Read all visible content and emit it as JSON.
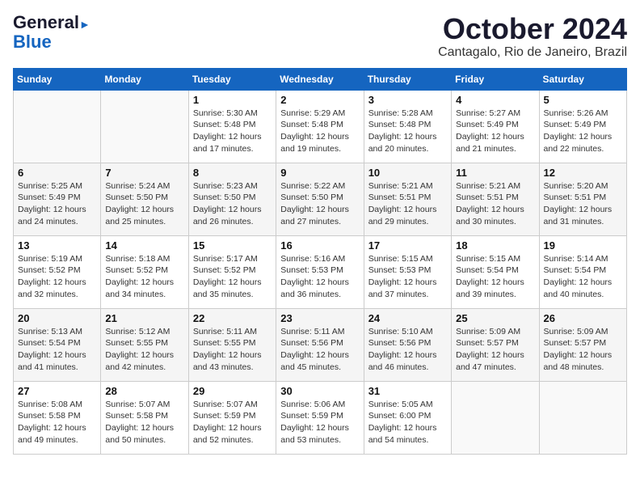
{
  "header": {
    "logo_line1": "General",
    "logo_line2": "Blue",
    "month": "October 2024",
    "location": "Cantagalo, Rio de Janeiro, Brazil"
  },
  "weekdays": [
    "Sunday",
    "Monday",
    "Tuesday",
    "Wednesday",
    "Thursday",
    "Friday",
    "Saturday"
  ],
  "weeks": [
    [
      {
        "day": "",
        "info": ""
      },
      {
        "day": "",
        "info": ""
      },
      {
        "day": "1",
        "info": "Sunrise: 5:30 AM\nSunset: 5:48 PM\nDaylight: 12 hours\nand 17 minutes."
      },
      {
        "day": "2",
        "info": "Sunrise: 5:29 AM\nSunset: 5:48 PM\nDaylight: 12 hours\nand 19 minutes."
      },
      {
        "day": "3",
        "info": "Sunrise: 5:28 AM\nSunset: 5:48 PM\nDaylight: 12 hours\nand 20 minutes."
      },
      {
        "day": "4",
        "info": "Sunrise: 5:27 AM\nSunset: 5:49 PM\nDaylight: 12 hours\nand 21 minutes."
      },
      {
        "day": "5",
        "info": "Sunrise: 5:26 AM\nSunset: 5:49 PM\nDaylight: 12 hours\nand 22 minutes."
      }
    ],
    [
      {
        "day": "6",
        "info": "Sunrise: 5:25 AM\nSunset: 5:49 PM\nDaylight: 12 hours\nand 24 minutes."
      },
      {
        "day": "7",
        "info": "Sunrise: 5:24 AM\nSunset: 5:50 PM\nDaylight: 12 hours\nand 25 minutes."
      },
      {
        "day": "8",
        "info": "Sunrise: 5:23 AM\nSunset: 5:50 PM\nDaylight: 12 hours\nand 26 minutes."
      },
      {
        "day": "9",
        "info": "Sunrise: 5:22 AM\nSunset: 5:50 PM\nDaylight: 12 hours\nand 27 minutes."
      },
      {
        "day": "10",
        "info": "Sunrise: 5:21 AM\nSunset: 5:51 PM\nDaylight: 12 hours\nand 29 minutes."
      },
      {
        "day": "11",
        "info": "Sunrise: 5:21 AM\nSunset: 5:51 PM\nDaylight: 12 hours\nand 30 minutes."
      },
      {
        "day": "12",
        "info": "Sunrise: 5:20 AM\nSunset: 5:51 PM\nDaylight: 12 hours\nand 31 minutes."
      }
    ],
    [
      {
        "day": "13",
        "info": "Sunrise: 5:19 AM\nSunset: 5:52 PM\nDaylight: 12 hours\nand 32 minutes."
      },
      {
        "day": "14",
        "info": "Sunrise: 5:18 AM\nSunset: 5:52 PM\nDaylight: 12 hours\nand 34 minutes."
      },
      {
        "day": "15",
        "info": "Sunrise: 5:17 AM\nSunset: 5:52 PM\nDaylight: 12 hours\nand 35 minutes."
      },
      {
        "day": "16",
        "info": "Sunrise: 5:16 AM\nSunset: 5:53 PM\nDaylight: 12 hours\nand 36 minutes."
      },
      {
        "day": "17",
        "info": "Sunrise: 5:15 AM\nSunset: 5:53 PM\nDaylight: 12 hours\nand 37 minutes."
      },
      {
        "day": "18",
        "info": "Sunrise: 5:15 AM\nSunset: 5:54 PM\nDaylight: 12 hours\nand 39 minutes."
      },
      {
        "day": "19",
        "info": "Sunrise: 5:14 AM\nSunset: 5:54 PM\nDaylight: 12 hours\nand 40 minutes."
      }
    ],
    [
      {
        "day": "20",
        "info": "Sunrise: 5:13 AM\nSunset: 5:54 PM\nDaylight: 12 hours\nand 41 minutes."
      },
      {
        "day": "21",
        "info": "Sunrise: 5:12 AM\nSunset: 5:55 PM\nDaylight: 12 hours\nand 42 minutes."
      },
      {
        "day": "22",
        "info": "Sunrise: 5:11 AM\nSunset: 5:55 PM\nDaylight: 12 hours\nand 43 minutes."
      },
      {
        "day": "23",
        "info": "Sunrise: 5:11 AM\nSunset: 5:56 PM\nDaylight: 12 hours\nand 45 minutes."
      },
      {
        "day": "24",
        "info": "Sunrise: 5:10 AM\nSunset: 5:56 PM\nDaylight: 12 hours\nand 46 minutes."
      },
      {
        "day": "25",
        "info": "Sunrise: 5:09 AM\nSunset: 5:57 PM\nDaylight: 12 hours\nand 47 minutes."
      },
      {
        "day": "26",
        "info": "Sunrise: 5:09 AM\nSunset: 5:57 PM\nDaylight: 12 hours\nand 48 minutes."
      }
    ],
    [
      {
        "day": "27",
        "info": "Sunrise: 5:08 AM\nSunset: 5:58 PM\nDaylight: 12 hours\nand 49 minutes."
      },
      {
        "day": "28",
        "info": "Sunrise: 5:07 AM\nSunset: 5:58 PM\nDaylight: 12 hours\nand 50 minutes."
      },
      {
        "day": "29",
        "info": "Sunrise: 5:07 AM\nSunset: 5:59 PM\nDaylight: 12 hours\nand 52 minutes."
      },
      {
        "day": "30",
        "info": "Sunrise: 5:06 AM\nSunset: 5:59 PM\nDaylight: 12 hours\nand 53 minutes."
      },
      {
        "day": "31",
        "info": "Sunrise: 5:05 AM\nSunset: 6:00 PM\nDaylight: 12 hours\nand 54 minutes."
      },
      {
        "day": "",
        "info": ""
      },
      {
        "day": "",
        "info": ""
      }
    ]
  ]
}
